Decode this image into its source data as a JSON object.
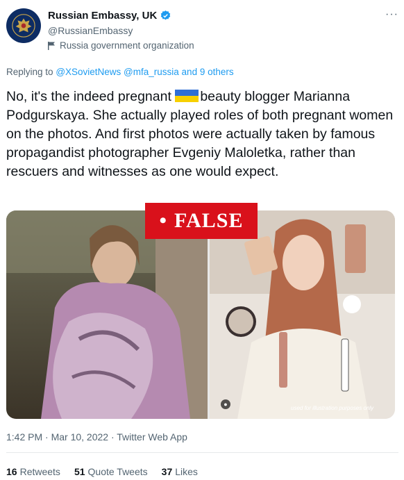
{
  "account": {
    "name": "Russian Embassy, UK",
    "handle": "@RussianEmbassy",
    "label": "Russia government organization",
    "more": "···"
  },
  "reply": {
    "prefix": "Replying to",
    "mentions": "@XSovietNews @mfa_russia",
    "others": "and 9 others"
  },
  "tweet": {
    "text_before_flag": "No, it's the indeed pregnant",
    "text_after_flag": "beauty blogger Marianna Podgurskaya. She actually played roles of both pregnant women on the photos. And first photos were actually taken by famous propagandist photographer Evgeniy Maloletka, rather than rescuers and witnesses as one would expect."
  },
  "media": {
    "badge": "FALSE",
    "badge_dot": "•",
    "caption": "used for illustration purposes only",
    "colors": {
      "badge": "#d9111b"
    }
  },
  "meta": {
    "timestamp": "1:42 PM · Mar 10, 2022 · Twitter Web App"
  },
  "stats": {
    "retweets_count": "16",
    "retweets_label": "Retweets",
    "quotes_count": "51",
    "quotes_label": "Quote Tweets",
    "likes_count": "37",
    "likes_label": "Likes"
  },
  "colors": {
    "link": "#1d9bf0",
    "muted": "#536471",
    "text": "#0f1419",
    "flag_blue": "#2e6fd6",
    "flag_yellow": "#f7d000"
  }
}
